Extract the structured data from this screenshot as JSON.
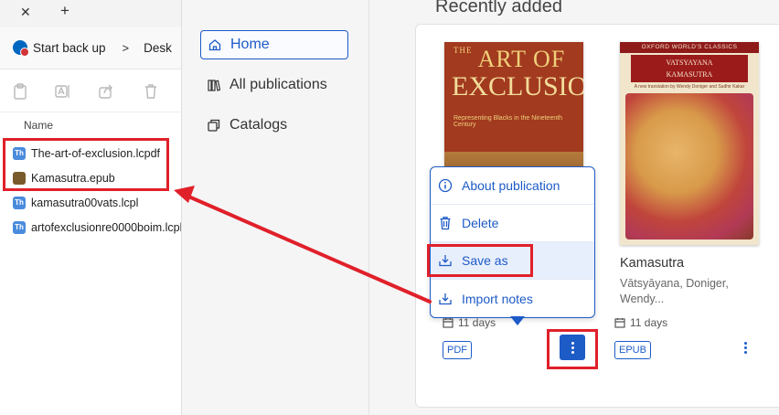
{
  "explorer": {
    "tab_close": "✕",
    "tab_new": "+",
    "breadcrumb": {
      "root": "Start back up",
      "separator": ">",
      "current": "Desk"
    },
    "toolbar": [
      {
        "icon": "clipboard-icon"
      },
      {
        "icon": "rename-icon"
      },
      {
        "icon": "share-icon"
      },
      {
        "icon": "trash-icon"
      }
    ],
    "column_header": "Name",
    "files": [
      {
        "name": "The-art-of-exclusion.lcpdf",
        "icon": "thorium-file-icon"
      },
      {
        "name": "Kamasutra.epub",
        "icon": "book-file-icon"
      },
      {
        "name": "kamasutra00vats.lcpl",
        "icon": "thorium-file-icon"
      },
      {
        "name": "artofexclusionre0000boim.lcpl",
        "icon": "thorium-file-icon"
      }
    ]
  },
  "nav": {
    "items": [
      {
        "label": "Home",
        "icon": "home-icon",
        "active": true
      },
      {
        "label": "All publications",
        "icon": "books-icon",
        "active": false
      },
      {
        "label": "Catalogs",
        "icon": "catalog-icon",
        "active": false
      }
    ]
  },
  "main": {
    "section_title": "Recently added",
    "books": [
      {
        "cover": {
          "line1": "THE",
          "line2": "ART OF",
          "line3": "EXCLUSION",
          "subtitle": "Representing Blacks in the Nineteenth Century"
        },
        "added": "11 days",
        "format": "PDF"
      },
      {
        "cover": {
          "series": "OXFORD WORLD'S CLASSICS",
          "title_line1": "VATSYAYANA",
          "title_line2": "KAMASUTRA",
          "credit": "A new translation by Wendy Doniger and Sudhir Kakar"
        },
        "title": "Kamasutra",
        "author": "Vātsyāyana, Doniger, Wendy...",
        "added": "11 days",
        "format": "EPUB"
      }
    ]
  },
  "menu": {
    "items": [
      {
        "label": "About publication",
        "icon": "info-icon"
      },
      {
        "label": "Delete",
        "icon": "trash-icon"
      },
      {
        "label": "Save as",
        "icon": "save-icon"
      },
      {
        "label": "Import notes",
        "icon": "import-icon"
      }
    ]
  },
  "colors": {
    "accent": "#1d5bc7",
    "annotation": "#e0202a"
  }
}
